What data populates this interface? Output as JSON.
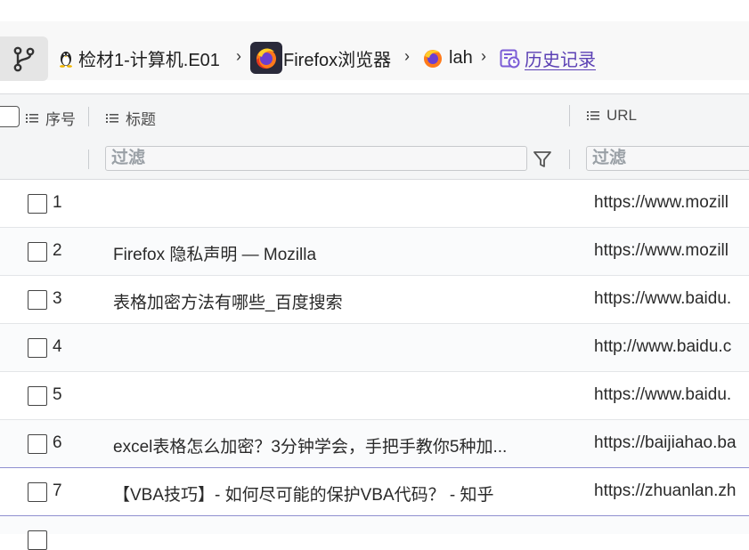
{
  "breadcrumb": {
    "items": [
      {
        "label": "检材1-计算机.E01",
        "icon": "linux-penguin-icon"
      },
      {
        "label": "Firefox浏览器",
        "icon": "firefox-icon"
      },
      {
        "label": "lah",
        "icon": "firefox-profile-icon"
      },
      {
        "label": "历史记录",
        "icon": "history-icon",
        "active": true
      }
    ],
    "separator": "›"
  },
  "table": {
    "columns": {
      "index": "序号",
      "title": "标题",
      "url": "URL"
    },
    "filter_placeholder": "过滤",
    "rows": [
      {
        "num": "1",
        "title": "",
        "url": "https://www.mozill"
      },
      {
        "num": "2",
        "title": "Firefox 隐私声明 — Mozilla",
        "url": "https://www.mozill"
      },
      {
        "num": "3",
        "title": "表格加密方法有哪些_百度搜索",
        "url": "https://www.baidu."
      },
      {
        "num": "4",
        "title": "",
        "url": "http://www.baidu.c"
      },
      {
        "num": "5",
        "title": "",
        "url": "https://www.baidu."
      },
      {
        "num": "6",
        "title": "excel表格怎么加密？3分钟学会，手把手教你5种加...",
        "url": "https://baijiahao.ba"
      },
      {
        "num": "7",
        "title": "【VBA技巧】- 如何尽可能的保护VBA代码？ - 知乎",
        "url": "https://zhuanlan.zh"
      }
    ]
  },
  "colors": {
    "accent": "#5a3fb4",
    "header_bg": "#f4f5f6"
  }
}
